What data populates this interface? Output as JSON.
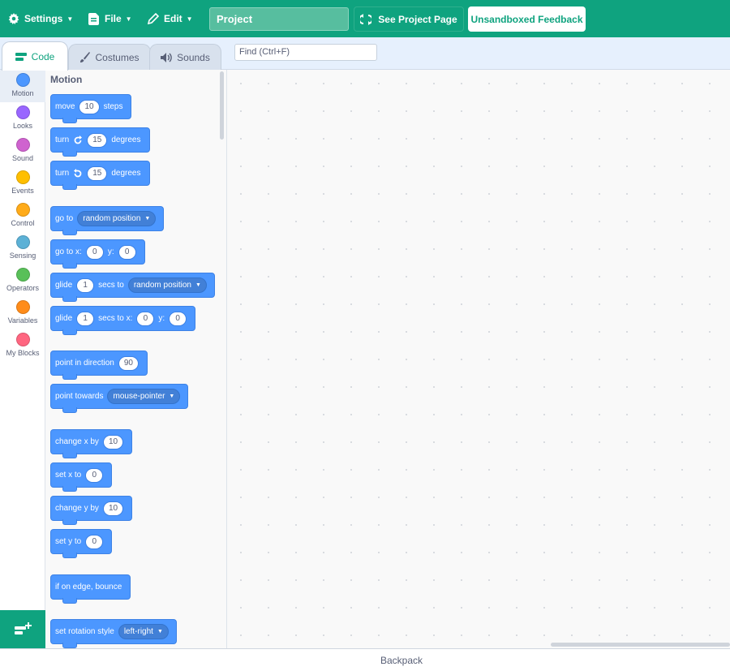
{
  "menubar": {
    "settings_label": "Settings",
    "file_label": "File",
    "edit_label": "Edit",
    "project_title": "Project",
    "see_project_label": "See Project Page",
    "feedback_label": "Unsandboxed Feedback",
    "icons": [
      "gear-icon",
      "file-icon",
      "pencil-icon",
      "remix-arrows-icon"
    ],
    "colors": {
      "bar": "#0fa37f",
      "text": "#ffffff"
    }
  },
  "tabs": {
    "code": "Code",
    "costumes": "Costumes",
    "sounds": "Sounds"
  },
  "find": {
    "placeholder": "Find (Ctrl+F)"
  },
  "categories": [
    {
      "label": "Motion",
      "color": "#4c97ff"
    },
    {
      "label": "Looks",
      "color": "#9966ff"
    },
    {
      "label": "Sound",
      "color": "#cf63cf"
    },
    {
      "label": "Events",
      "color": "#ffbf00"
    },
    {
      "label": "Control",
      "color": "#ffab19"
    },
    {
      "label": "Sensing",
      "color": "#5cb1d6"
    },
    {
      "label": "Operators",
      "color": "#59c059"
    },
    {
      "label": "Variables",
      "color": "#ff8c1a"
    },
    {
      "label": "My Blocks",
      "color": "#ff6680"
    }
  ],
  "palette": {
    "title": "Motion",
    "blocks": {
      "move": {
        "a": "move",
        "v1": "10",
        "b": "steps"
      },
      "turn_right": {
        "a": "turn",
        "v1": "15",
        "b": "degrees"
      },
      "turn_left": {
        "a": "turn",
        "v1": "15",
        "b": "degrees"
      },
      "goto": {
        "a": "go to",
        "menu": "random position"
      },
      "goto_xy": {
        "a": "go to x:",
        "v1": "0",
        "b": "y:",
        "v2": "0"
      },
      "glide_to": {
        "a": "glide",
        "v1": "1",
        "b": "secs to",
        "menu": "random position"
      },
      "glide_xy": {
        "a": "glide",
        "v1": "1",
        "b": "secs to x:",
        "v2": "0",
        "c": "y:",
        "v3": "0"
      },
      "point_dir": {
        "a": "point in direction",
        "v1": "90"
      },
      "point_towards": {
        "a": "point towards",
        "menu": "mouse-pointer"
      },
      "change_x": {
        "a": "change x by",
        "v1": "10"
      },
      "set_x": {
        "a": "set x to",
        "v1": "0"
      },
      "change_y": {
        "a": "change y by",
        "v1": "10"
      },
      "set_y": {
        "a": "set y to",
        "v1": "0"
      },
      "bounce": {
        "a": "if on edge, bounce"
      },
      "rotation_style": {
        "a": "set rotation style",
        "menu": "left-right"
      }
    },
    "block_color": "#4c97ff"
  },
  "backpack": {
    "label": "Backpack"
  }
}
